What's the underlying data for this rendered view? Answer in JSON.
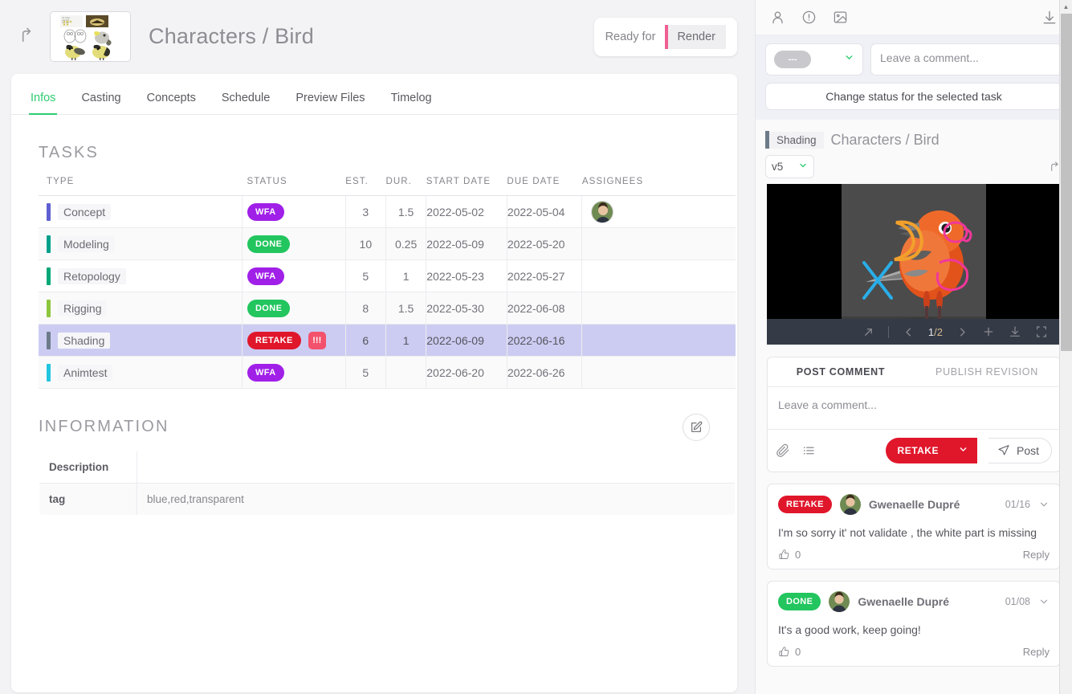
{
  "header": {
    "back_icon": "arrow-up-left-icon",
    "thumbnail_alt": "bird-reference-sheet-thumbnail",
    "title": "Characters / Bird",
    "ready_for_label": "Ready for",
    "ready_for_value": "Render",
    "ready_accent": "#ef5f92"
  },
  "tabs": [
    {
      "label": "Infos",
      "active": true
    },
    {
      "label": "Casting",
      "active": false
    },
    {
      "label": "Concepts",
      "active": false
    },
    {
      "label": "Schedule",
      "active": false
    },
    {
      "label": "Preview Files",
      "active": false
    },
    {
      "label": "Timelog",
      "active": false
    }
  ],
  "tasks_section": {
    "title": "TASKS",
    "columns": [
      "TYPE",
      "STATUS",
      "EST.",
      "DUR.",
      "START DATE",
      "DUE DATE",
      "ASSIGNEES"
    ],
    "rows": [
      {
        "type": "Concept",
        "type_color": "#5e5fd0",
        "status": "WFA",
        "status_color": "#a020e8",
        "priority": "",
        "est": "3",
        "dur": "1.5",
        "start": "2022-05-02",
        "due": "2022-05-04",
        "assignee": "avatar",
        "selected": false
      },
      {
        "type": "Modeling",
        "type_color": "#00a08b",
        "status": "DONE",
        "status_color": "#22c55e",
        "priority": "",
        "est": "10",
        "dur": "0.25",
        "start": "2022-05-09",
        "due": "2022-05-20",
        "assignee": "",
        "selected": false
      },
      {
        "type": "Retopology",
        "type_color": "#00a878",
        "status": "WFA",
        "status_color": "#a020e8",
        "priority": "",
        "est": "5",
        "dur": "1",
        "start": "2022-05-23",
        "due": "2022-05-27",
        "assignee": "",
        "selected": false
      },
      {
        "type": "Rigging",
        "type_color": "#8cc63e",
        "status": "DONE",
        "status_color": "#22c55e",
        "priority": "",
        "est": "8",
        "dur": "1.5",
        "start": "2022-05-30",
        "due": "2022-06-08",
        "assignee": "",
        "selected": false
      },
      {
        "type": "Shading",
        "type_color": "#6d7b89",
        "status": "RETAKE",
        "status_color": "#e0162b",
        "priority": "!!!",
        "est": "6",
        "dur": "1",
        "start": "2022-06-09",
        "due": "2022-06-16",
        "assignee": "",
        "selected": true
      },
      {
        "type": "Animtest",
        "type_color": "#22c5e0",
        "status": "WFA",
        "status_color": "#a020e8",
        "priority": "",
        "est": "5",
        "dur": "",
        "start": "2022-06-20",
        "due": "2022-06-26",
        "assignee": "",
        "selected": false
      }
    ]
  },
  "information_section": {
    "title": "INFORMATION",
    "edit_icon": "edit-pencil-icon",
    "rows": [
      {
        "key": "Description",
        "value": ""
      },
      {
        "key": "tag",
        "value": "blue,red,transparent"
      }
    ]
  },
  "sidebar": {
    "toolbar_icons": [
      "person-icon",
      "exclamation-circle-icon",
      "image-icon",
      "download-icon"
    ],
    "quick_status": {
      "selected_value": "---",
      "chevron_icon": "chevron-down-icon",
      "comment_placeholder": "Leave a comment...",
      "change_status_label": "Change status for the selected task"
    },
    "task_header": {
      "task_type": "Shading",
      "task_type_color": "#6d7b89",
      "entity_name": "Characters / Bird"
    },
    "version": {
      "selected": "v5",
      "chevron_icon": "chevron-down-icon",
      "open_external_icon": "arrow-up-right-icon"
    },
    "player": {
      "preview_alt": "orange-bird-3d-render-with-annotations",
      "expand_icon": "arrow-up-right-icon",
      "prev_icon": "chevron-left-icon",
      "frame_current": "1",
      "frame_total": "/2",
      "next_icon": "chevron-right-icon",
      "add_icon": "plus-icon",
      "download_icon": "download-icon",
      "fullscreen_icon": "fullscreen-icon"
    },
    "comment_box": {
      "tabs": [
        {
          "label": "POST COMMENT",
          "active": true
        },
        {
          "label": "PUBLISH REVISION",
          "active": false
        }
      ],
      "placeholder": "Leave a comment...",
      "attach_icon": "paperclip-icon",
      "checklist_icon": "list-icon",
      "status_button": "RETAKE",
      "status_button_color": "#e0162b",
      "status_chevron_icon": "chevron-down-icon",
      "post_icon": "send-icon",
      "post_label": "Post"
    },
    "comments": [
      {
        "status": "RETAKE",
        "status_color": "#e0162b",
        "avatar": "avatar",
        "author": "Gwenaelle Dupré",
        "date": "01/16",
        "chevron_icon": "chevron-down-icon",
        "text": "I'm so sorry it' not validate , the white part is missing",
        "like_icon": "thumbs-up-icon",
        "like_count": "0",
        "reply_label": "Reply"
      },
      {
        "status": "DONE",
        "status_color": "#22c55e",
        "avatar": "avatar",
        "author": "Gwenaelle Dupré",
        "date": "01/08",
        "chevron_icon": "chevron-down-icon",
        "text": "It's a good work, keep going!",
        "like_icon": "thumbs-up-icon",
        "like_count": "0",
        "reply_label": "Reply"
      }
    ]
  }
}
